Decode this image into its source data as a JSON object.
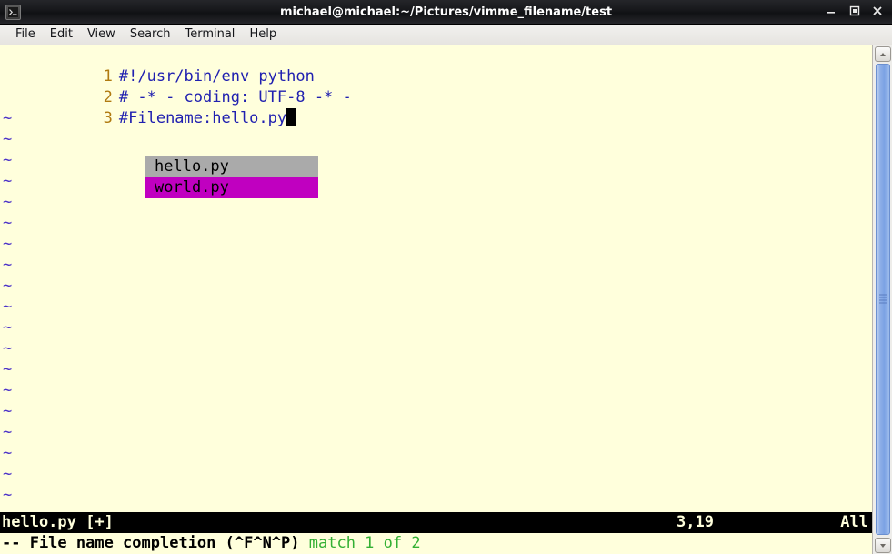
{
  "window": {
    "title": "michael@michael:~/Pictures/vimme_filename/test",
    "icon": "terminal-icon",
    "buttons": {
      "minimize": "minimize-icon",
      "maximize": "maximize-icon",
      "close": "close-icon"
    }
  },
  "menubar": {
    "items": [
      {
        "label": "File"
      },
      {
        "label": "Edit"
      },
      {
        "label": "View"
      },
      {
        "label": "Search"
      },
      {
        "label": "Terminal"
      },
      {
        "label": "Help"
      }
    ]
  },
  "editor": {
    "lines": [
      {
        "number": "1",
        "text": "#!/usr/bin/env python"
      },
      {
        "number": "2",
        "text": "# -* - coding: UTF-8 -* -"
      },
      {
        "number": "3",
        "text": "#Filename:hello.py"
      }
    ],
    "empty_marker": "~",
    "empty_marker_count": 19,
    "colors": {
      "background": "#ffffdc",
      "comment": "#2020b0",
      "line_number": "#b07a10",
      "tilde": "#4b32c8",
      "cursor": "#000000"
    }
  },
  "completion_popup": {
    "items": [
      {
        "label": "hello.py",
        "selected": false
      },
      {
        "label": "world.py",
        "selected": true
      }
    ],
    "colors": {
      "item_background": "#aaaaaa",
      "selected_background": "#c000c0",
      "text": "#000000"
    }
  },
  "statusline": {
    "filename": "hello.py [+]",
    "position": "3,19",
    "scroll": "All",
    "colors": {
      "background": "#000000",
      "text": "#ffffdc"
    }
  },
  "messageline": {
    "mode_text": "-- File name completion (^F^N^P) ",
    "match_text": "match 1 of 2",
    "colors": {
      "mode": "#000000",
      "match": "#33b033"
    }
  },
  "scrollbar": {
    "up_arrow": "chevron-up-icon",
    "down_arrow": "chevron-down-icon",
    "thumb": "scrollbar-thumb",
    "accent": "#7ba2e4"
  }
}
